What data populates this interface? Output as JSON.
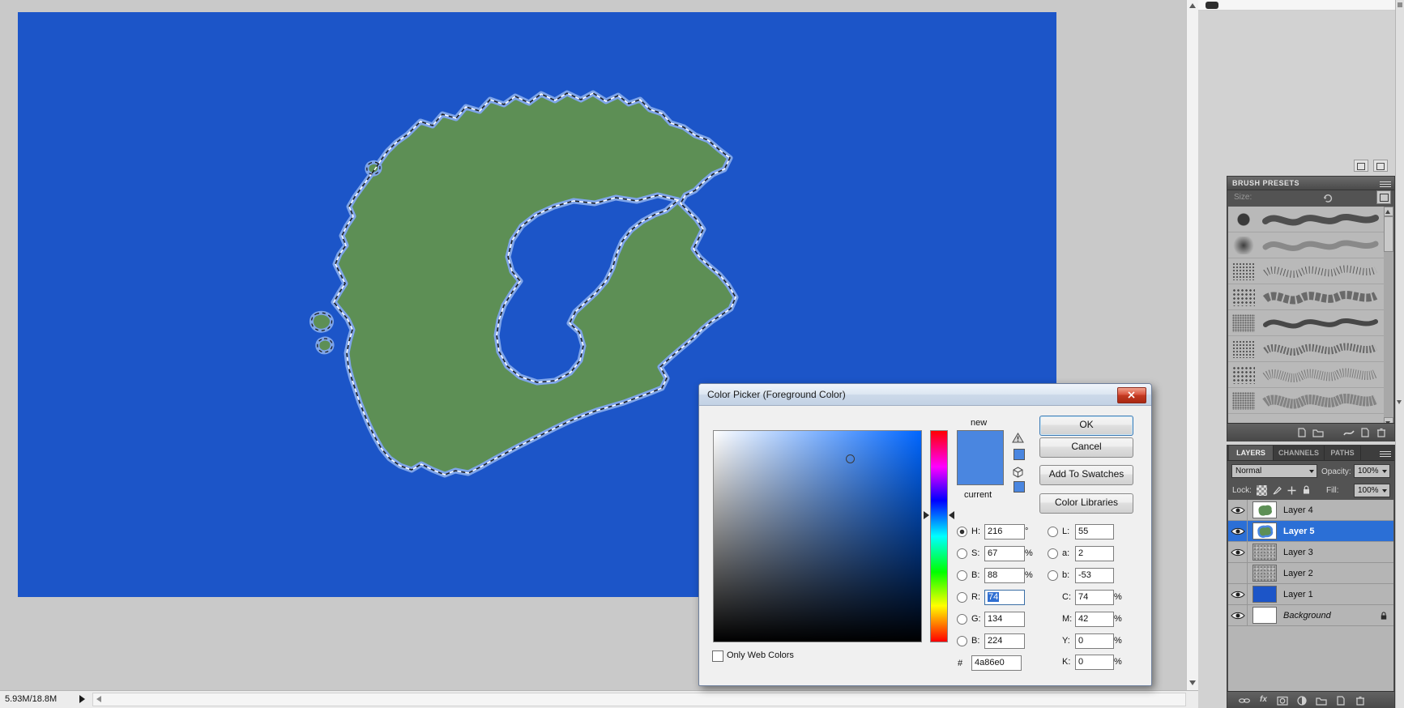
{
  "status_bar": {
    "doc_size": "5.93M/18.8M"
  },
  "canvas": {
    "background_color": "#1c55c8",
    "island_color": "#5d8f55",
    "selection_halo_color": "#7fa5e9"
  },
  "color_picker": {
    "title": "Color Picker (Foreground Color)",
    "new_label": "new",
    "current_label": "current",
    "ok": "OK",
    "cancel": "Cancel",
    "add_to_swatches": "Add To Swatches",
    "color_libraries": "Color Libraries",
    "only_web_colors": "Only Web Colors",
    "hex_prefix": "#",
    "hex": "4a86e0",
    "new_color": "#4a86e0",
    "current_color": "#4a86e0",
    "hsb": [
      {
        "label": "H:",
        "value": "216",
        "unit": "°"
      },
      {
        "label": "S:",
        "value": "67",
        "unit": "%"
      },
      {
        "label": "B:",
        "value": "88",
        "unit": "%"
      }
    ],
    "rgb": [
      {
        "label": "R:",
        "value": "74"
      },
      {
        "label": "G:",
        "value": "134"
      },
      {
        "label": "B:",
        "value": "224"
      }
    ],
    "lab": [
      {
        "label": "L:",
        "value": "55"
      },
      {
        "label": "a:",
        "value": "2"
      },
      {
        "label": "b:",
        "value": "-53"
      }
    ],
    "cmyk": [
      {
        "label": "C:",
        "value": "74",
        "unit": "%"
      },
      {
        "label": "M:",
        "value": "42",
        "unit": "%"
      },
      {
        "label": "Y:",
        "value": "0",
        "unit": "%"
      },
      {
        "label": "K:",
        "value": "0",
        "unit": "%"
      }
    ]
  },
  "brush_panel": {
    "title": "BRUSH PRESETS",
    "size_label": "Size:"
  },
  "layers_panel": {
    "tabs": [
      {
        "label": "LAYERS"
      },
      {
        "label": "CHANNELS"
      },
      {
        "label": "PATHS"
      }
    ],
    "blend_mode": "Normal",
    "opacity_label": "Opacity:",
    "opacity_value": "100%",
    "lock_label": "Lock:",
    "fill_label": "Fill:",
    "fill_value": "100%",
    "fx": "fx",
    "layers": [
      {
        "name": "Layer 4",
        "visible": true,
        "selected": false
      },
      {
        "name": "Layer 5",
        "visible": true,
        "selected": true
      },
      {
        "name": "Layer 3",
        "visible": true,
        "selected": false
      },
      {
        "name": "Layer 2",
        "visible": false,
        "selected": false
      },
      {
        "name": "Layer 1",
        "visible": true,
        "selected": false
      },
      {
        "name": "Background",
        "visible": true,
        "selected": false,
        "locked": true
      }
    ]
  }
}
